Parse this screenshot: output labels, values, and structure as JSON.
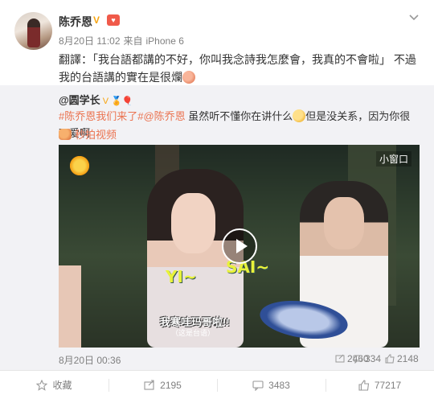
{
  "post": {
    "author": "陈乔恩",
    "verified_badge": "V",
    "date": "8月20日 11:02",
    "source_prefix": "来自",
    "source": "iPhone 6",
    "text": "翻譯：「我台語都講的不好，你叫我念詩我怎麼會，我真的不會啦」 不過我的台語講的實在是很爛",
    "emoji_icon": "peach-face-emoji-icon"
  },
  "repost": {
    "author": "@圆学长",
    "author_badges": "V 🏅🎈",
    "topic1": "#陈乔恩我们来了#",
    "mention": "@陈乔恩",
    "text_before": " 虽然听不懂你在讲什么",
    "text_after": "但是没关系，因为你很可爱啊",
    "video_link": "秒拍视频",
    "video": {
      "small_window": "小窗口",
      "caption_yi": "YI~",
      "caption_sai": "SAI~",
      "subtitle": "我寒哇玛哥啦!!",
      "subtitle_small": "（这是台语）"
    },
    "date": "8月20日 00:36",
    "repost_count": "2460",
    "comment_count": "334",
    "like_count": "2148"
  },
  "actions": {
    "favorite": "收藏",
    "repost": "2195",
    "comment": "3483",
    "like": "77217"
  },
  "colors": {
    "link": "#eb7350",
    "meta": "#808080",
    "repost_bg": "#f2f2f5",
    "badge": "#f7a40f"
  }
}
